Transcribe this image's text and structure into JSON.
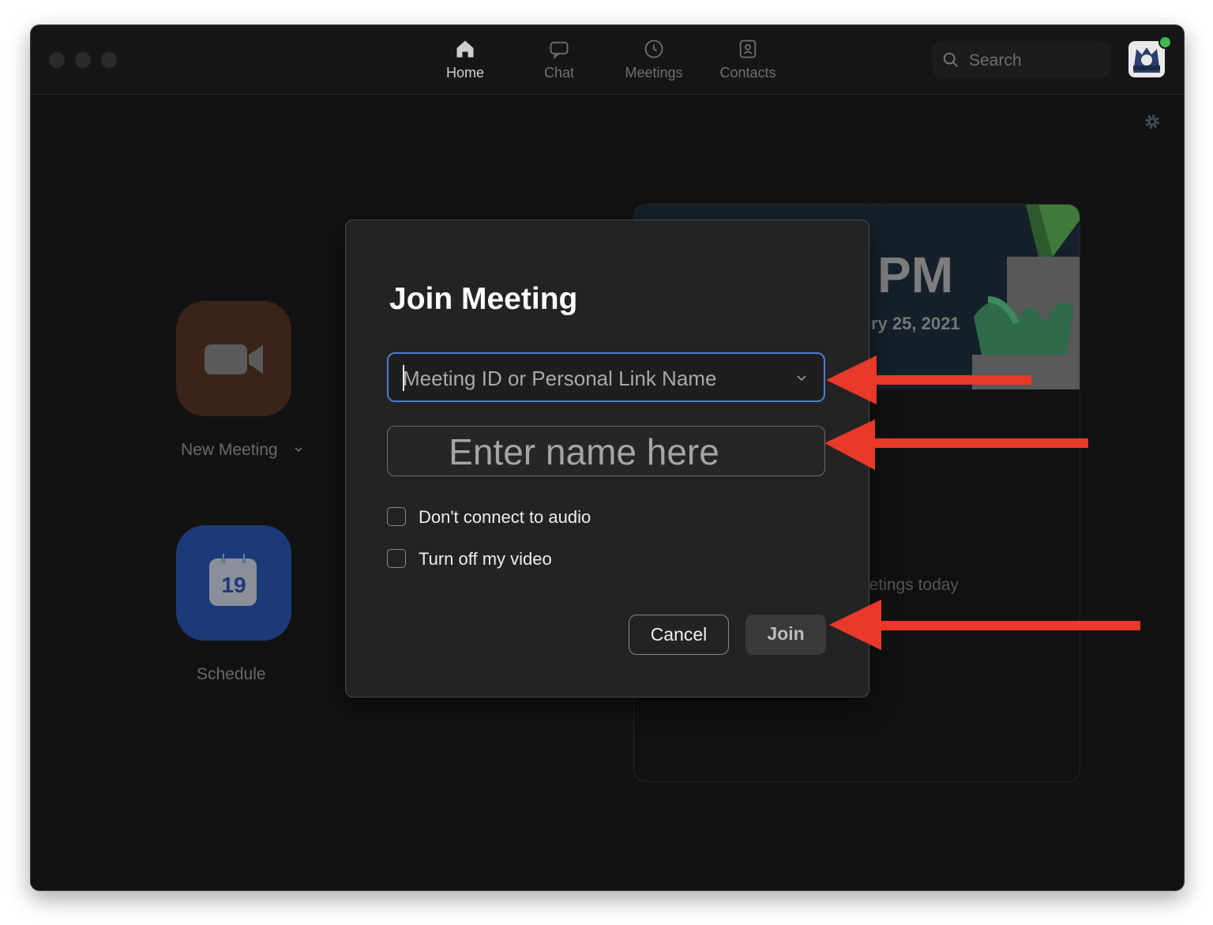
{
  "nav": {
    "tabs": [
      {
        "label": "Home",
        "icon": "home-icon"
      },
      {
        "label": "Chat",
        "icon": "chat-icon"
      },
      {
        "label": "Meetings",
        "icon": "clock-icon"
      },
      {
        "label": "Contacts",
        "icon": "contacts-icon"
      }
    ],
    "active": "Home"
  },
  "search": {
    "placeholder": "Search"
  },
  "home": {
    "new_meeting_label": "New Meeting",
    "schedule_label": "Schedule",
    "calendar_day": "19"
  },
  "card": {
    "time": "PM",
    "date": "ry 25, 2021",
    "empty": "eetings today"
  },
  "dialog": {
    "title": "Join Meeting",
    "meeting_placeholder": "Meeting ID or Personal Link Name",
    "name_value": "Enter name here",
    "audio_label": "Don't connect to audio",
    "video_label": "Turn off my video",
    "cancel_label": "Cancel",
    "join_label": "Join"
  },
  "colors": {
    "accent_focus": "#4a7bd4",
    "annotation_arrow": "#e8392a",
    "status_online": "#3fb950"
  }
}
